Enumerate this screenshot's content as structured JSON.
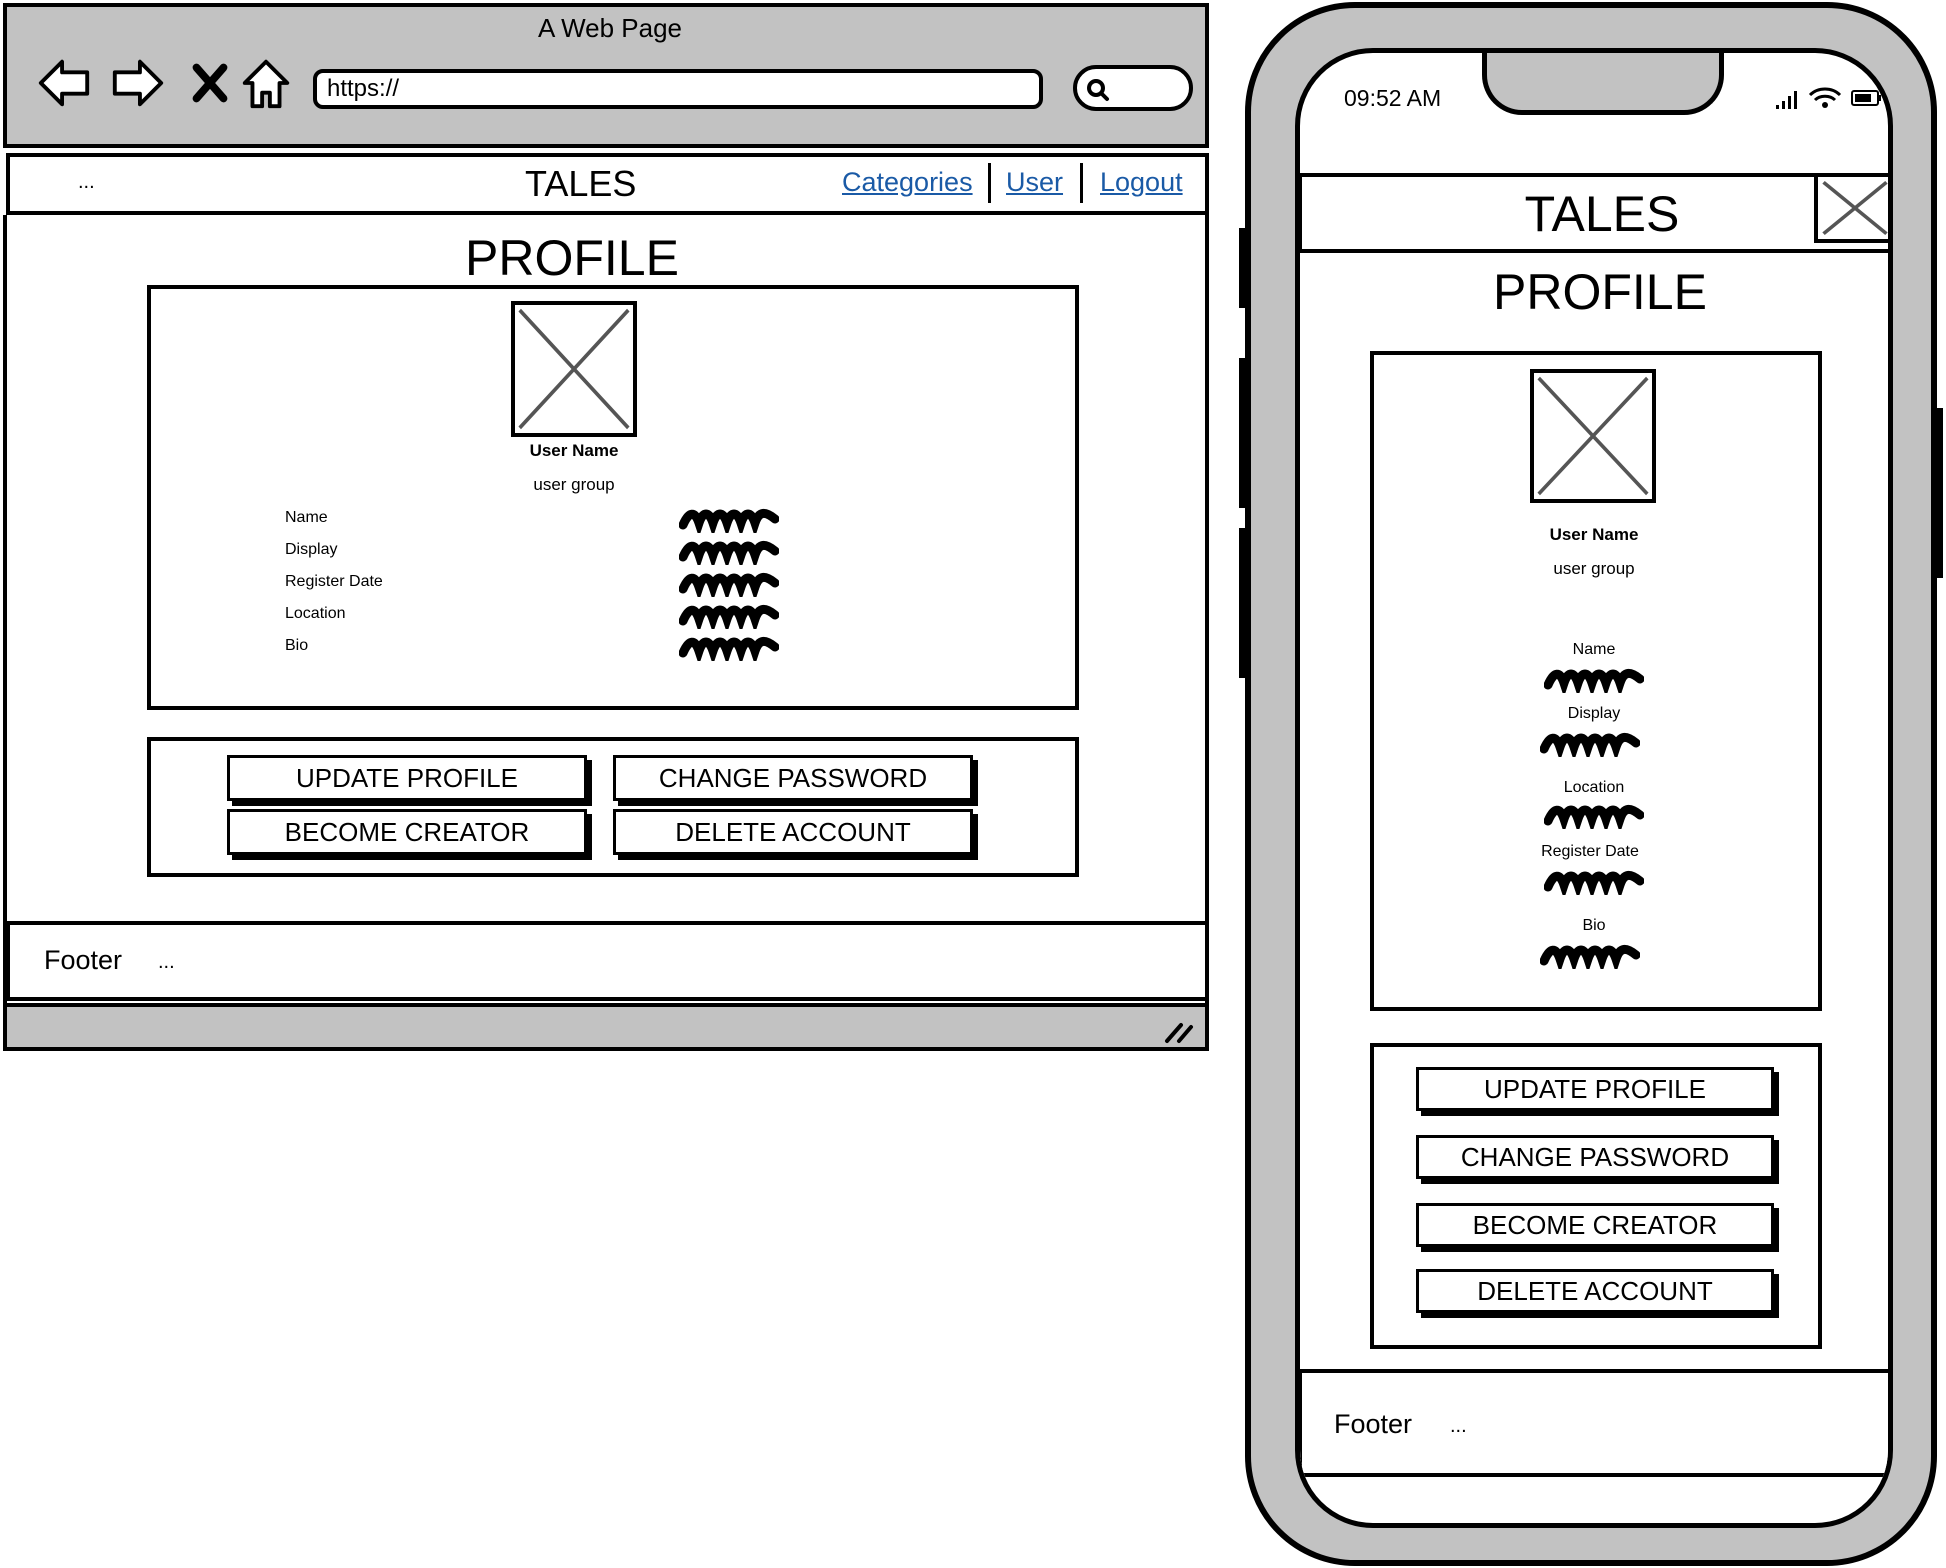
{
  "browser": {
    "window_title": "A Web Page",
    "url": "https://",
    "nav_icons": [
      "back-arrow-icon",
      "forward-arrow-icon",
      "stop-icon",
      "home-icon"
    ],
    "search_icon": "search-icon"
  },
  "header": {
    "menu_ellipsis": "...",
    "brand": "TALES",
    "links": [
      "Categories",
      "User",
      "Logout"
    ],
    "link_color": "#1a5aa6"
  },
  "profile": {
    "title": "PROFILE",
    "user_name": "User Name",
    "user_group": "user group",
    "desktop_fields": [
      "Name",
      "Display",
      "Register Date",
      "Location",
      "Bio"
    ],
    "mobile_fields": [
      "Name",
      "Display",
      "Location",
      "Register Date",
      "Bio"
    ]
  },
  "actions": {
    "update_profile": "UPDATE PROFILE",
    "change_password": "CHANGE PASSWORD",
    "become_creator": "BECOME CREATOR",
    "delete_account": "DELETE ACCOUNT"
  },
  "footer": {
    "label": "Footer",
    "ellipsis": "..."
  },
  "phone": {
    "time": "09:52 AM"
  },
  "colors": {
    "chrome_gray": "#c2c2c2",
    "ink": "#000000",
    "placeholder_x": "#555555"
  }
}
